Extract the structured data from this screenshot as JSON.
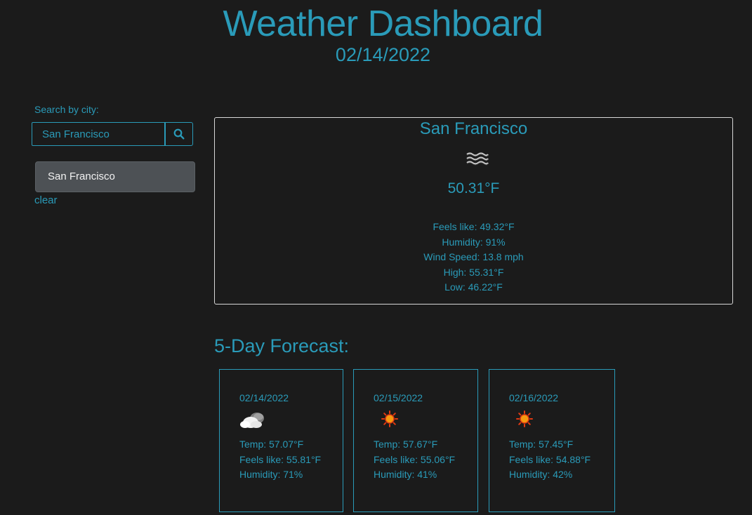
{
  "header": {
    "title": "Weather Dashboard",
    "date": "02/14/2022"
  },
  "search": {
    "label": "Search by city:",
    "value": "San Francisco",
    "button_icon": "search-icon"
  },
  "history": {
    "items": [
      {
        "label": "San Francisco"
      }
    ],
    "clear_label": "clear"
  },
  "current": {
    "city": "San Francisco",
    "icon": "fog-icon",
    "temp": "50.31°F",
    "feels_like": "Feels like: 49.32°F",
    "humidity": "Humidity: 91%",
    "wind": "Wind Speed: 13.8 mph",
    "high": "High: 55.31°F",
    "low": "Low: 46.22°F"
  },
  "forecast": {
    "title": "5-Day Forecast:",
    "days": [
      {
        "date": "02/14/2022",
        "icon": "partly-cloudy-icon",
        "temp": "Temp: 57.07°F",
        "feels_like": "Feels like: 55.81°F",
        "humidity": "Humidity: 71%"
      },
      {
        "date": "02/15/2022",
        "icon": "sun-icon",
        "temp": "Temp: 57.67°F",
        "feels_like": "Feels like: 55.06°F",
        "humidity": "Humidity: 41%"
      },
      {
        "date": "02/16/2022",
        "icon": "sun-icon",
        "temp": "Temp: 57.45°F",
        "feels_like": "Feels like: 54.88°F",
        "humidity": "Humidity: 42%"
      }
    ]
  },
  "colors": {
    "background": "#1b1b1b",
    "accent": "#2a9bb9",
    "history_item_bg": "#4d5155",
    "card_border": "#d8d8d8"
  }
}
